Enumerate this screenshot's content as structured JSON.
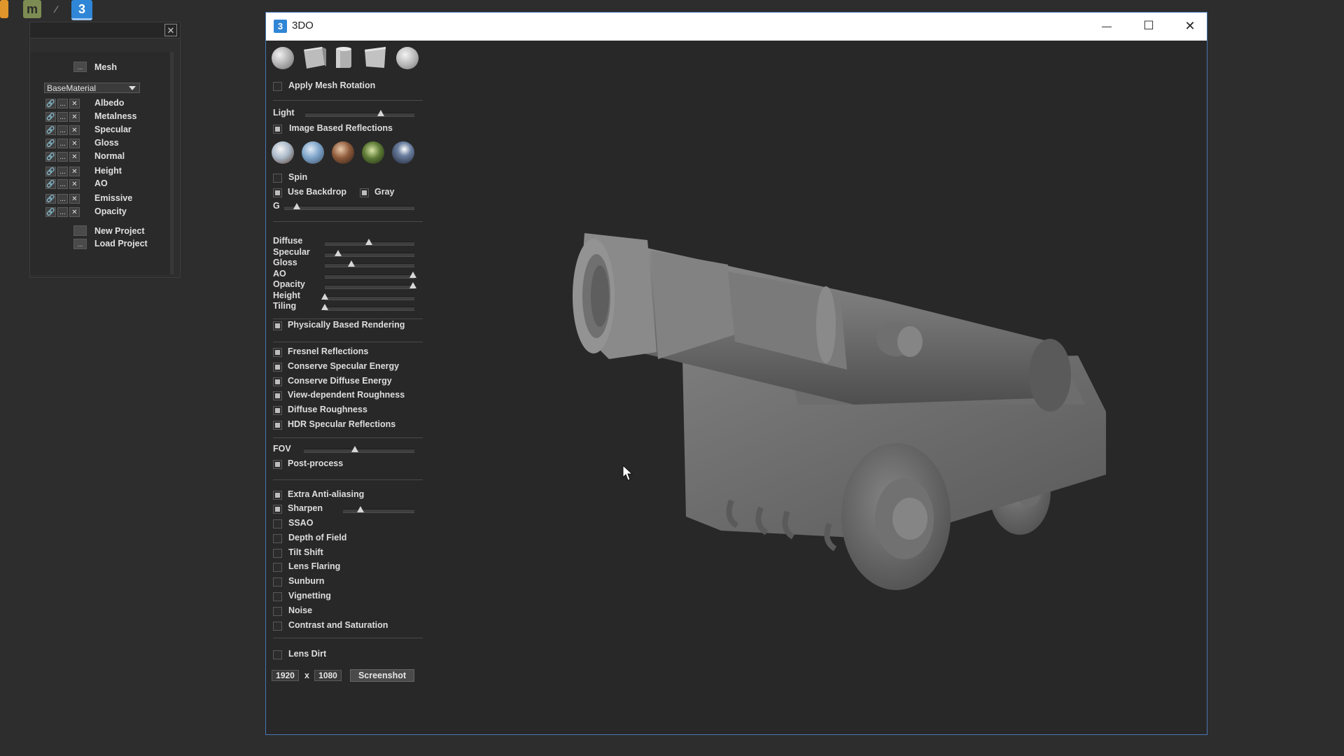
{
  "taskbar": {
    "icons": [
      "orange-app-icon",
      "mari-icon",
      "pen-icon",
      "3do-app-icon"
    ],
    "app3do_glyph": "3",
    "mari_glyph": "m"
  },
  "material_panel": {
    "close_glyph": "✕",
    "mesh_label": "Mesh",
    "browse_glyph": "...",
    "material_select": "BaseMaterial",
    "maps": [
      "Albedo",
      "Metalness",
      "Specular",
      "Gloss",
      "Normal",
      "Height",
      "AO",
      "Emissive",
      "Opacity"
    ],
    "new_project": "New Project",
    "load_project": "Load Project"
  },
  "window": {
    "title": "3DO",
    "icon_glyph": "3",
    "minimize_glyph": "—",
    "maximize_glyph": "☐",
    "close_glyph": "✕"
  },
  "controls": {
    "mesh_shapes": [
      "sphere",
      "cube",
      "cylinder",
      "plane",
      "sphere-textured"
    ],
    "apply_mesh_rotation": {
      "label": "Apply Mesh Rotation",
      "checked": false
    },
    "light": {
      "label": "Light",
      "value": 0.7
    },
    "image_based_reflections": {
      "label": "Image Based Reflections",
      "checked": true
    },
    "env_presets": [
      "env-sky-icon",
      "env-blue-icon",
      "env-interior-icon",
      "env-forest-icon",
      "env-night-icon"
    ],
    "spin": {
      "label": "Spin",
      "checked": false
    },
    "use_backdrop": {
      "label": "Use Backdrop",
      "checked": true
    },
    "gray": {
      "label": "Gray",
      "checked": true
    },
    "g": {
      "label": "G",
      "value": 0.1
    },
    "material_sliders": [
      {
        "label": "Diffuse",
        "value": 0.5
      },
      {
        "label": "Specular",
        "value": 0.15
      },
      {
        "label": "Gloss",
        "value": 0.3
      },
      {
        "label": "AO",
        "value": 1.0
      },
      {
        "label": "Opacity",
        "value": 1.0
      },
      {
        "label": "Height",
        "value": 0.0
      },
      {
        "label": "Tiling",
        "value": 0.0
      }
    ],
    "physically_based_rendering": {
      "label": "Physically Based Rendering",
      "checked": true
    },
    "pbr_options": [
      {
        "label": "Fresnel Reflections",
        "checked": true
      },
      {
        "label": "Conserve Specular Energy",
        "checked": true
      },
      {
        "label": "Conserve Diffuse Energy",
        "checked": true
      },
      {
        "label": "View-dependent Roughness",
        "checked": true
      },
      {
        "label": "Diffuse Roughness",
        "checked": true
      },
      {
        "label": "HDR Specular Reflections",
        "checked": true
      }
    ],
    "fov": {
      "label": "FOV",
      "value": 0.47
    },
    "post_process": {
      "label": "Post-process",
      "checked": true
    },
    "extra_antialiasing": {
      "label": "Extra Anti-aliasing",
      "checked": true
    },
    "sharpen": {
      "label": "Sharpen",
      "checked": true,
      "value": 0.25
    },
    "post_options": [
      {
        "label": "SSAO",
        "checked": false
      },
      {
        "label": "Depth of Field",
        "checked": false
      },
      {
        "label": "Tilt Shift",
        "checked": false
      },
      {
        "label": "Lens Flaring",
        "checked": false
      },
      {
        "label": "Sunburn",
        "checked": false
      },
      {
        "label": "Vignetting",
        "checked": false
      },
      {
        "label": "Noise",
        "checked": false
      },
      {
        "label": "Contrast and Saturation",
        "checked": false
      }
    ],
    "lens_dirt": {
      "label": "Lens Dirt",
      "checked": false
    },
    "screenshot": {
      "width": "1920",
      "x_label": "x",
      "height": "1080",
      "button": "Screenshot"
    }
  },
  "colors": {
    "accent": "#2f86d6",
    "window_border": "#4a76b4",
    "viewport_bg": "#282828",
    "mesh_gray": "#7a7a7a"
  }
}
